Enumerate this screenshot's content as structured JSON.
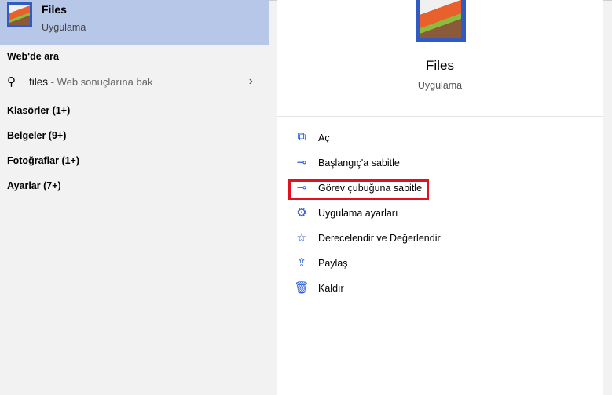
{
  "result": {
    "title": "Files",
    "subtitle": "Uygulama"
  },
  "web": {
    "header": "Web'de ara",
    "query": "files",
    "suffix": " - Web sonuçlarına bak"
  },
  "categories": [
    "Klasörler (1+)",
    "Belgeler (9+)",
    "Fotoğraflar (1+)",
    "Ayarlar (7+)"
  ],
  "detail": {
    "title": "Files",
    "subtitle": "Uygulama"
  },
  "actions": [
    {
      "icon": "open-icon",
      "glyph": "⧉",
      "label": "Aç"
    },
    {
      "icon": "pin-icon",
      "glyph": "⊸",
      "label": "Başlangıç'a sabitle"
    },
    {
      "icon": "pin-icon",
      "glyph": "⊸",
      "label": "Görev çubuğuna sabitle"
    },
    {
      "icon": "gear-icon",
      "glyph": "⚙",
      "label": "Uygulama ayarları"
    },
    {
      "icon": "star-list-icon",
      "glyph": "☆",
      "label": "Derecelendir ve Değerlendir"
    },
    {
      "icon": "share-icon",
      "glyph": "⇪",
      "label": "Paylaş"
    },
    {
      "icon": "trash-icon",
      "glyph": "🗑",
      "label": "Kaldır"
    }
  ],
  "colors": {
    "accent": "#2a5bd7",
    "highlight": "#e3101f",
    "selected": "#b7c7e7"
  }
}
